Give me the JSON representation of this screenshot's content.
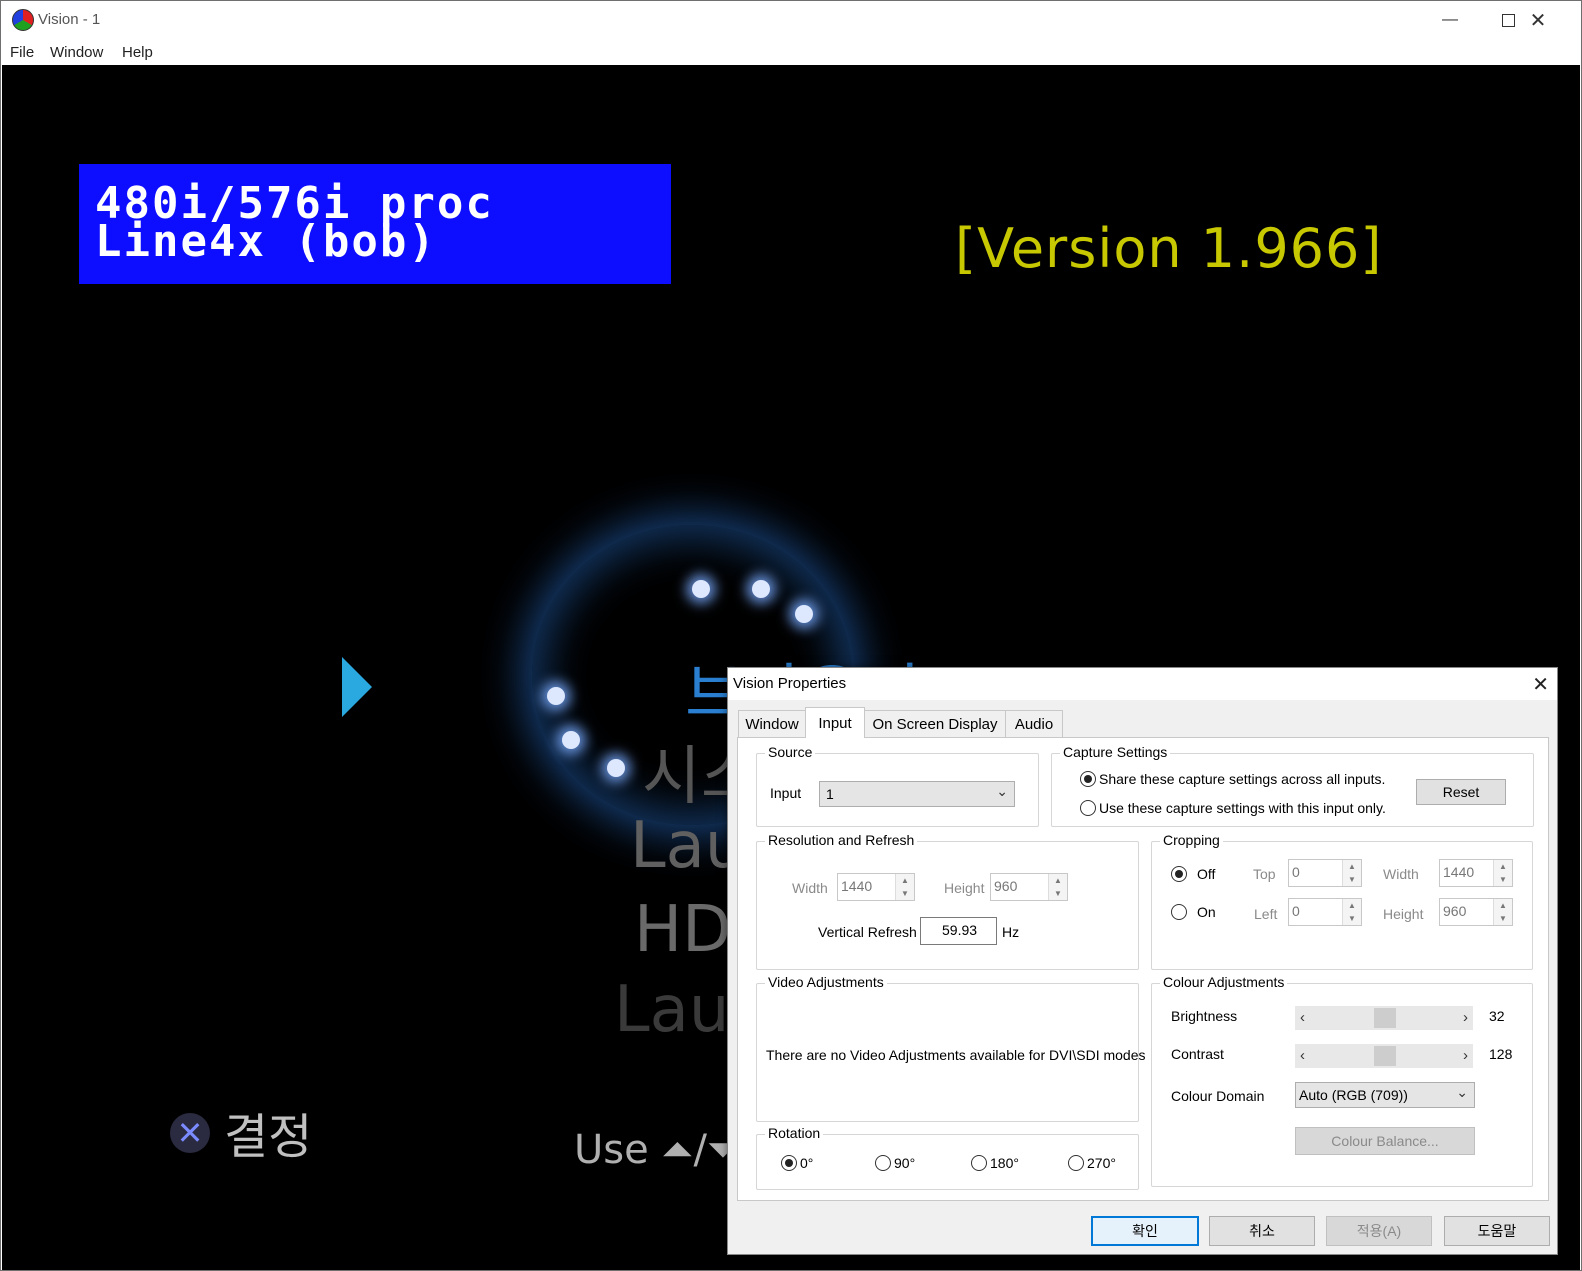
{
  "window": {
    "title": "Vision - 1"
  },
  "menu": [
    "File",
    "Window",
    "Help"
  ],
  "video": {
    "osd_line1": "480i/576i proc",
    "osd_line2": "Line4x (bob)",
    "version": "[Version 1.966]",
    "menu_partial_1": "브라우저",
    "menu_partial_2": "시스",
    "menu_partial_3": "Lau",
    "menu_partial_4": "HD",
    "menu_partial_5": "Lau",
    "confirm": "결정",
    "use_hint": "Use ⏶/⏷"
  },
  "dialog": {
    "title": "Vision Properties",
    "tabs": [
      "Window",
      "Input",
      "On Screen Display",
      "Audio"
    ],
    "active_tab": "Input",
    "source": {
      "label": "Source",
      "input_label": "Input",
      "input_value": "1"
    },
    "capture": {
      "label": "Capture Settings",
      "option_share": "Share these capture settings across all inputs.",
      "option_this": "Use these capture settings with this input only.",
      "reset": "Reset"
    },
    "resolution": {
      "label": "Resolution and Refresh",
      "width_label": "Width",
      "width_value": "1440",
      "height_label": "Height",
      "height_value": "960",
      "refresh_label": "Vertical Refresh",
      "refresh_value": "59.93",
      "refresh_unit": "Hz"
    },
    "cropping": {
      "label": "Cropping",
      "off": "Off",
      "on": "On",
      "top_label": "Top",
      "top_value": "0",
      "left_label": "Left",
      "left_value": "0",
      "width_label": "Width",
      "width_value": "1440",
      "height_label": "Height",
      "height_value": "960"
    },
    "video_adjustments": {
      "label": "Video Adjustments",
      "message": "There are no Video Adjustments available for DVI\\SDI modes"
    },
    "colour": {
      "label": "Colour Adjustments",
      "brightness_label": "Brightness",
      "brightness_value": "32",
      "contrast_label": "Contrast",
      "contrast_value": "128",
      "domain_label": "Colour Domain",
      "domain_value": "Auto (RGB (709))",
      "balance_button": "Colour Balance..."
    },
    "rotation": {
      "label": "Rotation",
      "options": [
        "0°",
        "90°",
        "180°",
        "270°"
      ],
      "selected": "0°"
    },
    "buttons": {
      "ok": "확인",
      "cancel": "취소",
      "apply": "적용(A)",
      "help": "도움말"
    }
  }
}
